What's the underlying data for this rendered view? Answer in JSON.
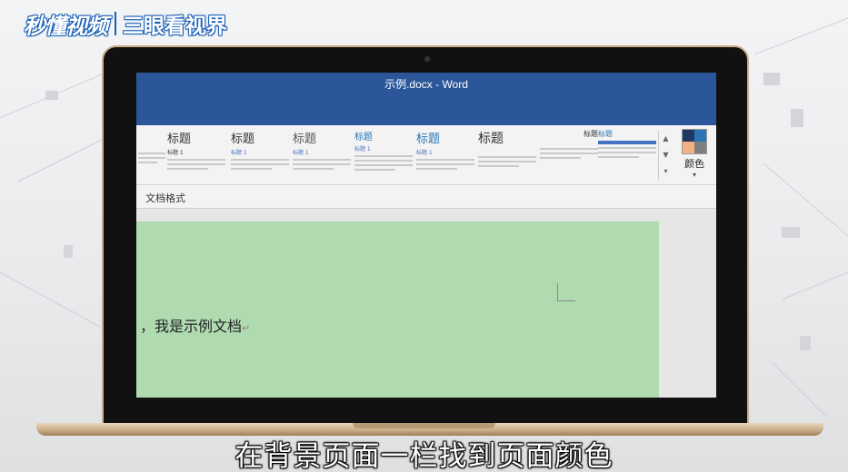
{
  "watermark": {
    "logo": "秒懂视频",
    "channel": "三眼看视界"
  },
  "window": {
    "title": "示例.docx  -  Word"
  },
  "ribbon": {
    "styles": [
      {
        "title": "标题",
        "sub": ""
      },
      {
        "title": "标题",
        "sub": "标题 1"
      },
      {
        "title": "标题",
        "sub": "标题 1"
      },
      {
        "title": "标题",
        "sub": "标题 1"
      },
      {
        "title": "标题",
        "sub": "标题 1"
      },
      {
        "title": "标题",
        "sub": ""
      },
      {
        "title": "标题",
        "sub": ""
      },
      {
        "title": "标题",
        "sub": ""
      }
    ],
    "colors_label": "颜色",
    "group_label": "文档格式"
  },
  "document": {
    "text": "，我是示例文档",
    "page_color": "#b0dbb0"
  },
  "caption": "在背景页面一栏找到页面颜色",
  "colors": {
    "titlebar": "#2b579a",
    "swatch": [
      "#1f3864",
      "#2e75b6",
      "#f4b183",
      "#7f7f7f"
    ]
  }
}
